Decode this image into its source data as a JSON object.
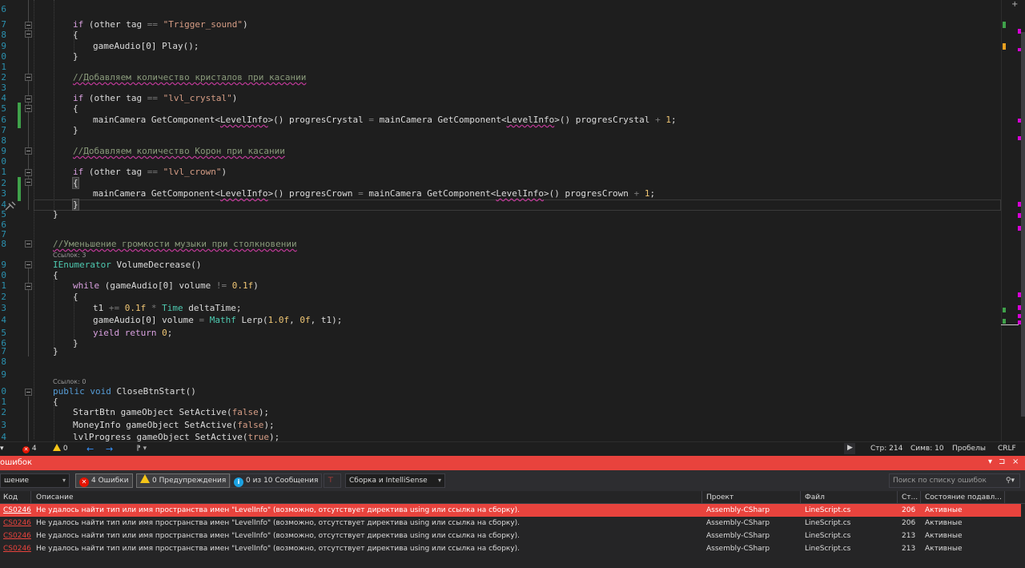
{
  "editor": {
    "line_numbers": [
      "6",
      "7",
      "8",
      "9",
      "0",
      "1",
      "2",
      "3",
      "4",
      "5",
      "6",
      "7",
      "8",
      "9",
      "0",
      "1",
      "2",
      "3",
      "4",
      "5",
      "6",
      "7",
      "8",
      "9",
      "0",
      "1",
      "2",
      "3",
      "4",
      "5",
      "6",
      "7",
      "8",
      "9",
      "0",
      "1",
      "2",
      "3",
      "4"
    ],
    "codelens": [
      "Ссылок: 3",
      "Ссылок: 0"
    ],
    "lines": {
      "if_sound": {
        "kw": "if",
        "a": " (other tag ",
        "op": "==",
        "b": " ",
        "str": "\"Trigger_sound\"",
        "c": ")"
      },
      "open1": "{",
      "play": "gameAudio[0] Play();",
      "close1": "}",
      "comment1": "//Добавляем количество кристалов при касании",
      "if_crystal": {
        "kw": "if",
        "a": " (other tag ",
        "op": "==",
        "b": " ",
        "str": "\"lvl_crystal\"",
        "c": ")"
      },
      "open2": "{",
      "crystal_stmt": {
        "a": "mainCamera GetComponent<",
        "t1": "LevelInfo",
        "b": ">() progresCrystal ",
        "op": "=",
        "c": " mainCamera GetComponent<",
        "t2": "LevelInfo",
        "d": ">() progresCrystal ",
        "op2": "+",
        "e": " ",
        "n": "1",
        "f": ";"
      },
      "close2": "}",
      "comment2": "//Добавляем количество Корон при касании",
      "if_crown": {
        "kw": "if",
        "a": " (other tag ",
        "op": "==",
        "b": " ",
        "str": "\"lvl_crown\"",
        "c": ")"
      },
      "open3": "{",
      "crown_stmt": {
        "a": "mainCamera GetComponent<",
        "t1": "LevelInfo",
        "b": ">() progresCrown ",
        "op": "=",
        "c": " mainCamera GetComponent<",
        "t2": "LevelInfo",
        "d": ">() progresCrown ",
        "op2": "+",
        "e": " ",
        "n": "1",
        "f": ";"
      },
      "close3": "}",
      "close_method": "}",
      "comment3": "//Уменьшение громкости музыки при столкновении",
      "ienum": {
        "t": "IEnumerator",
        "a": " VolumeDecrease()"
      },
      "open4": "{",
      "while": {
        "kw": "while",
        "a": " (gameAudio[0] volume ",
        "op": "!=",
        "b": " ",
        "n": "0.1f",
        "c": ")"
      },
      "open5": "{",
      "t1_stmt": {
        "a": "t1 ",
        "op": "+=",
        "b": " ",
        "n": "0.1f",
        "c": " ",
        "op2": "*",
        "d": " ",
        "t": "Time",
        "e": " deltaTime;"
      },
      "lerp_stmt": {
        "a": "gameAudio[0] volume ",
        "op": "=",
        "b": " ",
        "t": "Mathf",
        "c": " Lerp(",
        "n1": "1.0f",
        "d": ", ",
        "n2": "0f",
        "e": ", t1);"
      },
      "yield_stmt": {
        "kw": "yield return",
        "a": " ",
        "n": "0",
        "b": ";"
      },
      "close5": "}",
      "close4": "}",
      "close_btn": {
        "kw1": "public",
        "kw2": "void",
        "a": " CloseBtnStart()"
      },
      "open6": "{",
      "start_btn": {
        "a": "StartBtn gameObject SetActive(",
        "v": "false",
        "b": ");"
      },
      "money_info": {
        "a": "MoneyInfo gameObject SetActive(",
        "v": "false",
        "b": ");"
      },
      "lvl_progress": {
        "a": "lvlProgress gameObject SetActive(",
        "v": "true",
        "b": ");"
      }
    }
  },
  "statusbar": {
    "errors": "4",
    "warnings": "0",
    "line": "Стр: 214",
    "col": "Симв: 10",
    "spaces": "Пробелы",
    "eol": "CRLF"
  },
  "error_list": {
    "title": "ошибок",
    "title_controls": [
      "▾",
      "⊐",
      "×"
    ],
    "scope": "шение",
    "errors_btn": "4 Ошибки",
    "warnings_btn": "0 Предупреждения",
    "messages_btn": "0 из 10 Сообщения",
    "build_filter": "Сборка и IntelliSense",
    "search_placeholder": "Поиск по списку ошибок",
    "columns": {
      "code": "Код",
      "desc": "Описание",
      "project": "Проект",
      "file": "Файл",
      "line": "Ст...",
      "state": "Состояние подавл..."
    },
    "rows": [
      {
        "code": "CS0246",
        "desc": "Не удалось найти тип или имя пространства имен \"LevelInfo\" (возможно, отсутствует директива using или ссылка на сборку).",
        "project": "Assembly-CSharp",
        "file": "LineScript.cs",
        "line": "206",
        "state": "Активные"
      },
      {
        "code": "CS0246",
        "desc": "Не удалось найти тип или имя пространства имен \"LevelInfo\" (возможно, отсутствует директива using или ссылка на сборку).",
        "project": "Assembly-CSharp",
        "file": "LineScript.cs",
        "line": "206",
        "state": "Активные"
      },
      {
        "code": "CS0246",
        "desc": "Не удалось найти тип или имя пространства имен \"LevelInfo\" (возможно, отсутствует директива using или ссылка на сборку).",
        "project": "Assembly-CSharp",
        "file": "LineScript.cs",
        "line": "213",
        "state": "Активные"
      },
      {
        "code": "CS0246",
        "desc": "Не удалось найти тип или имя пространства имен \"LevelInfo\" (возможно, отсутствует директива using или ссылка на сборку).",
        "project": "Assembly-CSharp",
        "file": "LineScript.cs",
        "line": "213",
        "state": "Активные"
      }
    ]
  },
  "colors": {
    "error_red": "#e8433d",
    "editor_bg": "#1e1e1e",
    "change_green": "#3fa14a",
    "keyword_purple": "#d8a0df",
    "type_teal": "#4ec9b0",
    "string_brown": "#d69d85"
  }
}
